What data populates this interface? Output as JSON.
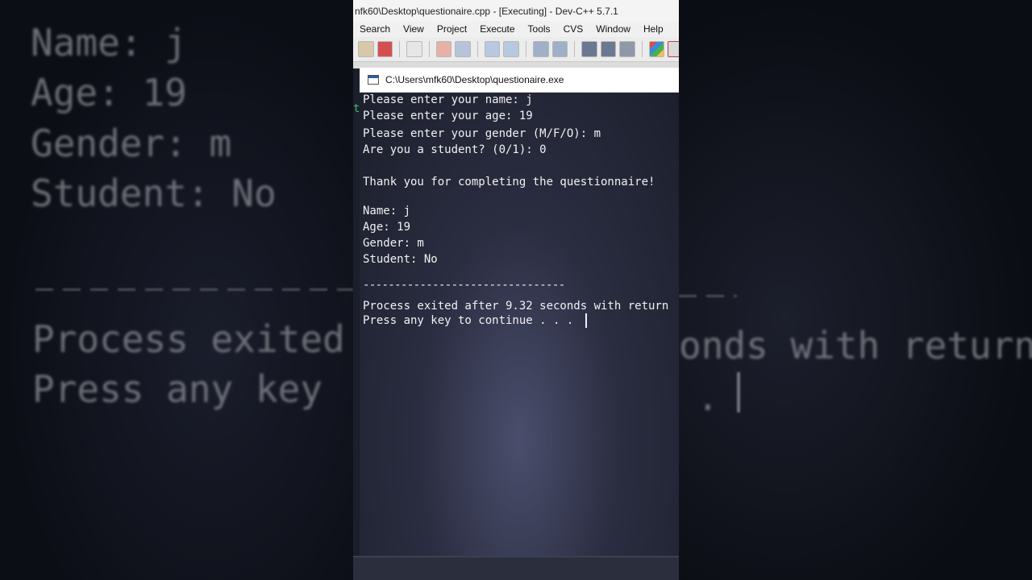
{
  "ide": {
    "title": "nfk60\\Desktop\\questionaire.cpp - [Executing] - Dev-C++ 5.7.1",
    "menu": [
      "Search",
      "View",
      "Project",
      "Execute",
      "Tools",
      "CVS",
      "Window",
      "Help"
    ]
  },
  "console": {
    "title": "C:\\Users\\mfk60\\Desktop\\questionaire.exe",
    "lines": [
      "Please enter your name: j",
      "Please enter your age: 19",
      "Please enter your gender (M/F/O): m",
      "Are you a student? (0/1): 0",
      "",
      "Thank you for completing the questionnaire!",
      "",
      "Name: j",
      "Age: 19",
      "Gender: m",
      "Student: No",
      "",
      "--------------------------------",
      "Process exited after 9.32 seconds with return",
      "Press any key to continue . . ."
    ]
  },
  "background": {
    "left_lines": [
      "Name: j",
      "Age: 19",
      "Gender: m",
      "Student: No",
      "Process exited",
      "Press any key"
    ],
    "right_lines": [
      "onds with return",
      "."
    ]
  }
}
